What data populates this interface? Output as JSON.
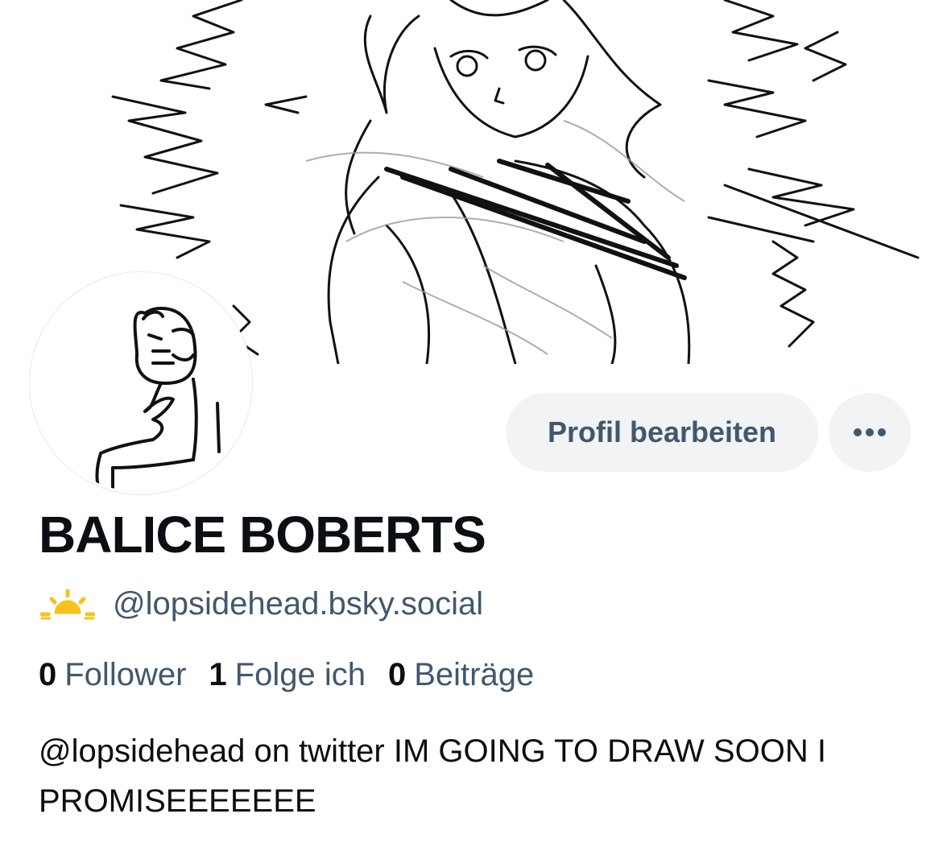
{
  "profile": {
    "display_name": "BALICE BOBERTS",
    "handle": "@lopsidehead.bsky.social",
    "bio": "@lopsidehead on twitter IM GOING TO DRAW SOON I PROMISEEEEEEE",
    "stats": {
      "followers_count": "0",
      "followers_label": "Follower",
      "following_count": "1",
      "following_label": "Folge ich",
      "posts_count": "0",
      "posts_label": "Beiträge"
    }
  },
  "actions": {
    "edit_profile_label": "Profil bearbeiten",
    "more_icon": "ellipsis-icon"
  },
  "icons": {
    "handle_badge": "sunrise-icon"
  },
  "colors": {
    "text_primary": "#0b0f14",
    "text_secondary": "#42576c",
    "button_bg": "#f1f3f5",
    "badge_yellow": "#f7c21b"
  }
}
